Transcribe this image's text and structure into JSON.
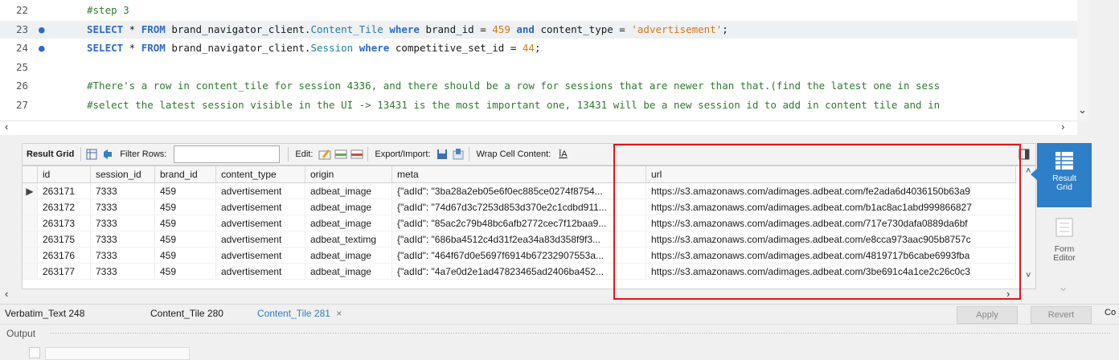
{
  "editor": {
    "lines": [
      {
        "num": "22",
        "marker": "",
        "highlighted": false,
        "tokens": [
          {
            "t": "cm",
            "v": "#step 3"
          }
        ]
      },
      {
        "num": "23",
        "marker": "●",
        "highlighted": true,
        "tokens": [
          {
            "t": "kw",
            "v": "SELECT"
          },
          {
            "t": "plain",
            "v": " * "
          },
          {
            "t": "kw",
            "v": "FROM"
          },
          {
            "t": "plain",
            "v": " brand_navigator_client."
          },
          {
            "t": "tb",
            "v": "Content_Tile"
          },
          {
            "t": "plain",
            "v": " "
          },
          {
            "t": "kw",
            "v": "where"
          },
          {
            "t": "plain",
            "v": " brand_id = "
          },
          {
            "t": "num",
            "v": "459"
          },
          {
            "t": "plain",
            "v": " "
          },
          {
            "t": "kw",
            "v": "and"
          },
          {
            "t": "plain",
            "v": " content_type = "
          },
          {
            "t": "str",
            "v": "'advertisement'"
          },
          {
            "t": "plain",
            "v": ";"
          }
        ]
      },
      {
        "num": "24",
        "marker": "●",
        "highlighted": false,
        "tokens": [
          {
            "t": "kw",
            "v": "SELECT"
          },
          {
            "t": "plain",
            "v": " * "
          },
          {
            "t": "kw",
            "v": "FROM"
          },
          {
            "t": "plain",
            "v": " brand_navigator_client."
          },
          {
            "t": "tb",
            "v": "Session"
          },
          {
            "t": "plain",
            "v": " "
          },
          {
            "t": "kw",
            "v": "where"
          },
          {
            "t": "plain",
            "v": " competitive_set_id = "
          },
          {
            "t": "num",
            "v": "44"
          },
          {
            "t": "plain",
            "v": ";"
          }
        ]
      },
      {
        "num": "25",
        "marker": "",
        "highlighted": false,
        "tokens": []
      },
      {
        "num": "26",
        "marker": "",
        "highlighted": false,
        "tokens": [
          {
            "t": "cm",
            "v": "#There's a row in content_tile for session 4336, and there should be a row for sessions that are newer than that.(find the latest one in sess"
          }
        ]
      },
      {
        "num": "27",
        "marker": "",
        "highlighted": false,
        "tokens": [
          {
            "t": "cm",
            "v": "#select the latest session visible in the UI -> 13431 is the most important one, 13431 will be a new session id to add in content tile and in"
          }
        ]
      }
    ]
  },
  "toolbar": {
    "result_grid_label": "Result Grid",
    "filter_rows_label": "Filter Rows:",
    "filter_value": "",
    "edit_label": "Edit:",
    "export_import_label": "Export/Import:",
    "wrap_cell_label": "Wrap Cell Content:",
    "wrap_icon_glyph": "ĪA"
  },
  "grid": {
    "columns": [
      "id",
      "session_id",
      "brand_id",
      "content_type",
      "origin",
      "meta",
      "url"
    ],
    "rows": [
      [
        "263171",
        "7333",
        "459",
        "advertisement",
        "adbeat_image",
        "{\"adId\": \"3ba28a2eb05e6f0ec885ce0274f8754...",
        "https://s3.amazonaws.com/adimages.adbeat.com/fe2ada6d4036150b63a9"
      ],
      [
        "263172",
        "7333",
        "459",
        "advertisement",
        "adbeat_image",
        "{\"adId\": \"74d67d3c7253d853d370e2c1cdbd911...",
        "https://s3.amazonaws.com/adimages.adbeat.com/b1ac8ac1abd999866827"
      ],
      [
        "263173",
        "7333",
        "459",
        "advertisement",
        "adbeat_image",
        "{\"adId\": \"85ac2c79b48bc6afb2772cec7f12baa9...",
        "https://s3.amazonaws.com/adimages.adbeat.com/717e730dafa0889da6bf"
      ],
      [
        "263175",
        "7333",
        "459",
        "advertisement",
        "adbeat_textimg",
        "{\"adId\": \"686ba4512c4d31f2ea34a83d358f9f3...",
        "https://s3.amazonaws.com/adimages.adbeat.com/e8cca973aac905b8757c"
      ],
      [
        "263176",
        "7333",
        "459",
        "advertisement",
        "adbeat_image",
        "{\"adId\": \"464f67d0e5697f6914b67232907553a...",
        "https://s3.amazonaws.com/adimages.adbeat.com/4819717b6cabe6993fba"
      ],
      [
        "263177",
        "7333",
        "459",
        "advertisement",
        "adbeat_image",
        "{\"adId\": \"4a7e0d2e1ad47823465ad2406ba452...",
        "https://s3.amazonaws.com/adimages.adbeat.com/3be691c4a1ce2c26c0c3"
      ]
    ],
    "current_row_marker": "▶"
  },
  "side_panel": {
    "result_grid_label_1": "Result",
    "result_grid_label_2": "Grid",
    "form_editor_label_1": "Form",
    "form_editor_label_2": "Editor"
  },
  "tabs": [
    {
      "label": "Verbatim_Text 248",
      "active": false
    },
    {
      "label": "Content_Tile 280",
      "active": false
    },
    {
      "label": "Content_Tile 281",
      "active": true,
      "close": "×"
    }
  ],
  "actions": {
    "apply_label": "Apply",
    "revert_label": "Revert",
    "cut_label": "Co"
  },
  "output": {
    "label": "Output"
  },
  "colors": {
    "accent": "#2d7fc8",
    "highlight_box": "#e8131b",
    "keyword": "#2a6bc9",
    "comment": "#2e7a2e",
    "string": "#d07a14"
  }
}
